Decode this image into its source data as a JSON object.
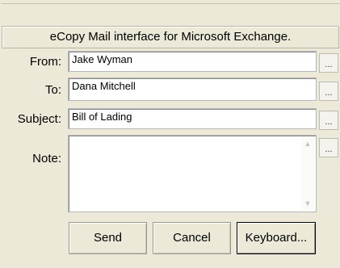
{
  "header": {
    "title": "eCopy Mail interface for Microsoft Exchange."
  },
  "form": {
    "from_label": "From:",
    "from_value": "Jake Wyman",
    "to_label": "To:",
    "to_value": "Dana Mitchell",
    "subject_label": "Subject:",
    "subject_value": "Bill of Lading",
    "note_label": "Note:",
    "note_value": "",
    "browse_label": "..."
  },
  "buttons": {
    "send": "Send",
    "cancel": "Cancel",
    "keyboard": "Keyboard..."
  },
  "icons": {
    "scroll_up": "scroll-up-arrow-icon",
    "scroll_down": "scroll-down-arrow-icon"
  }
}
